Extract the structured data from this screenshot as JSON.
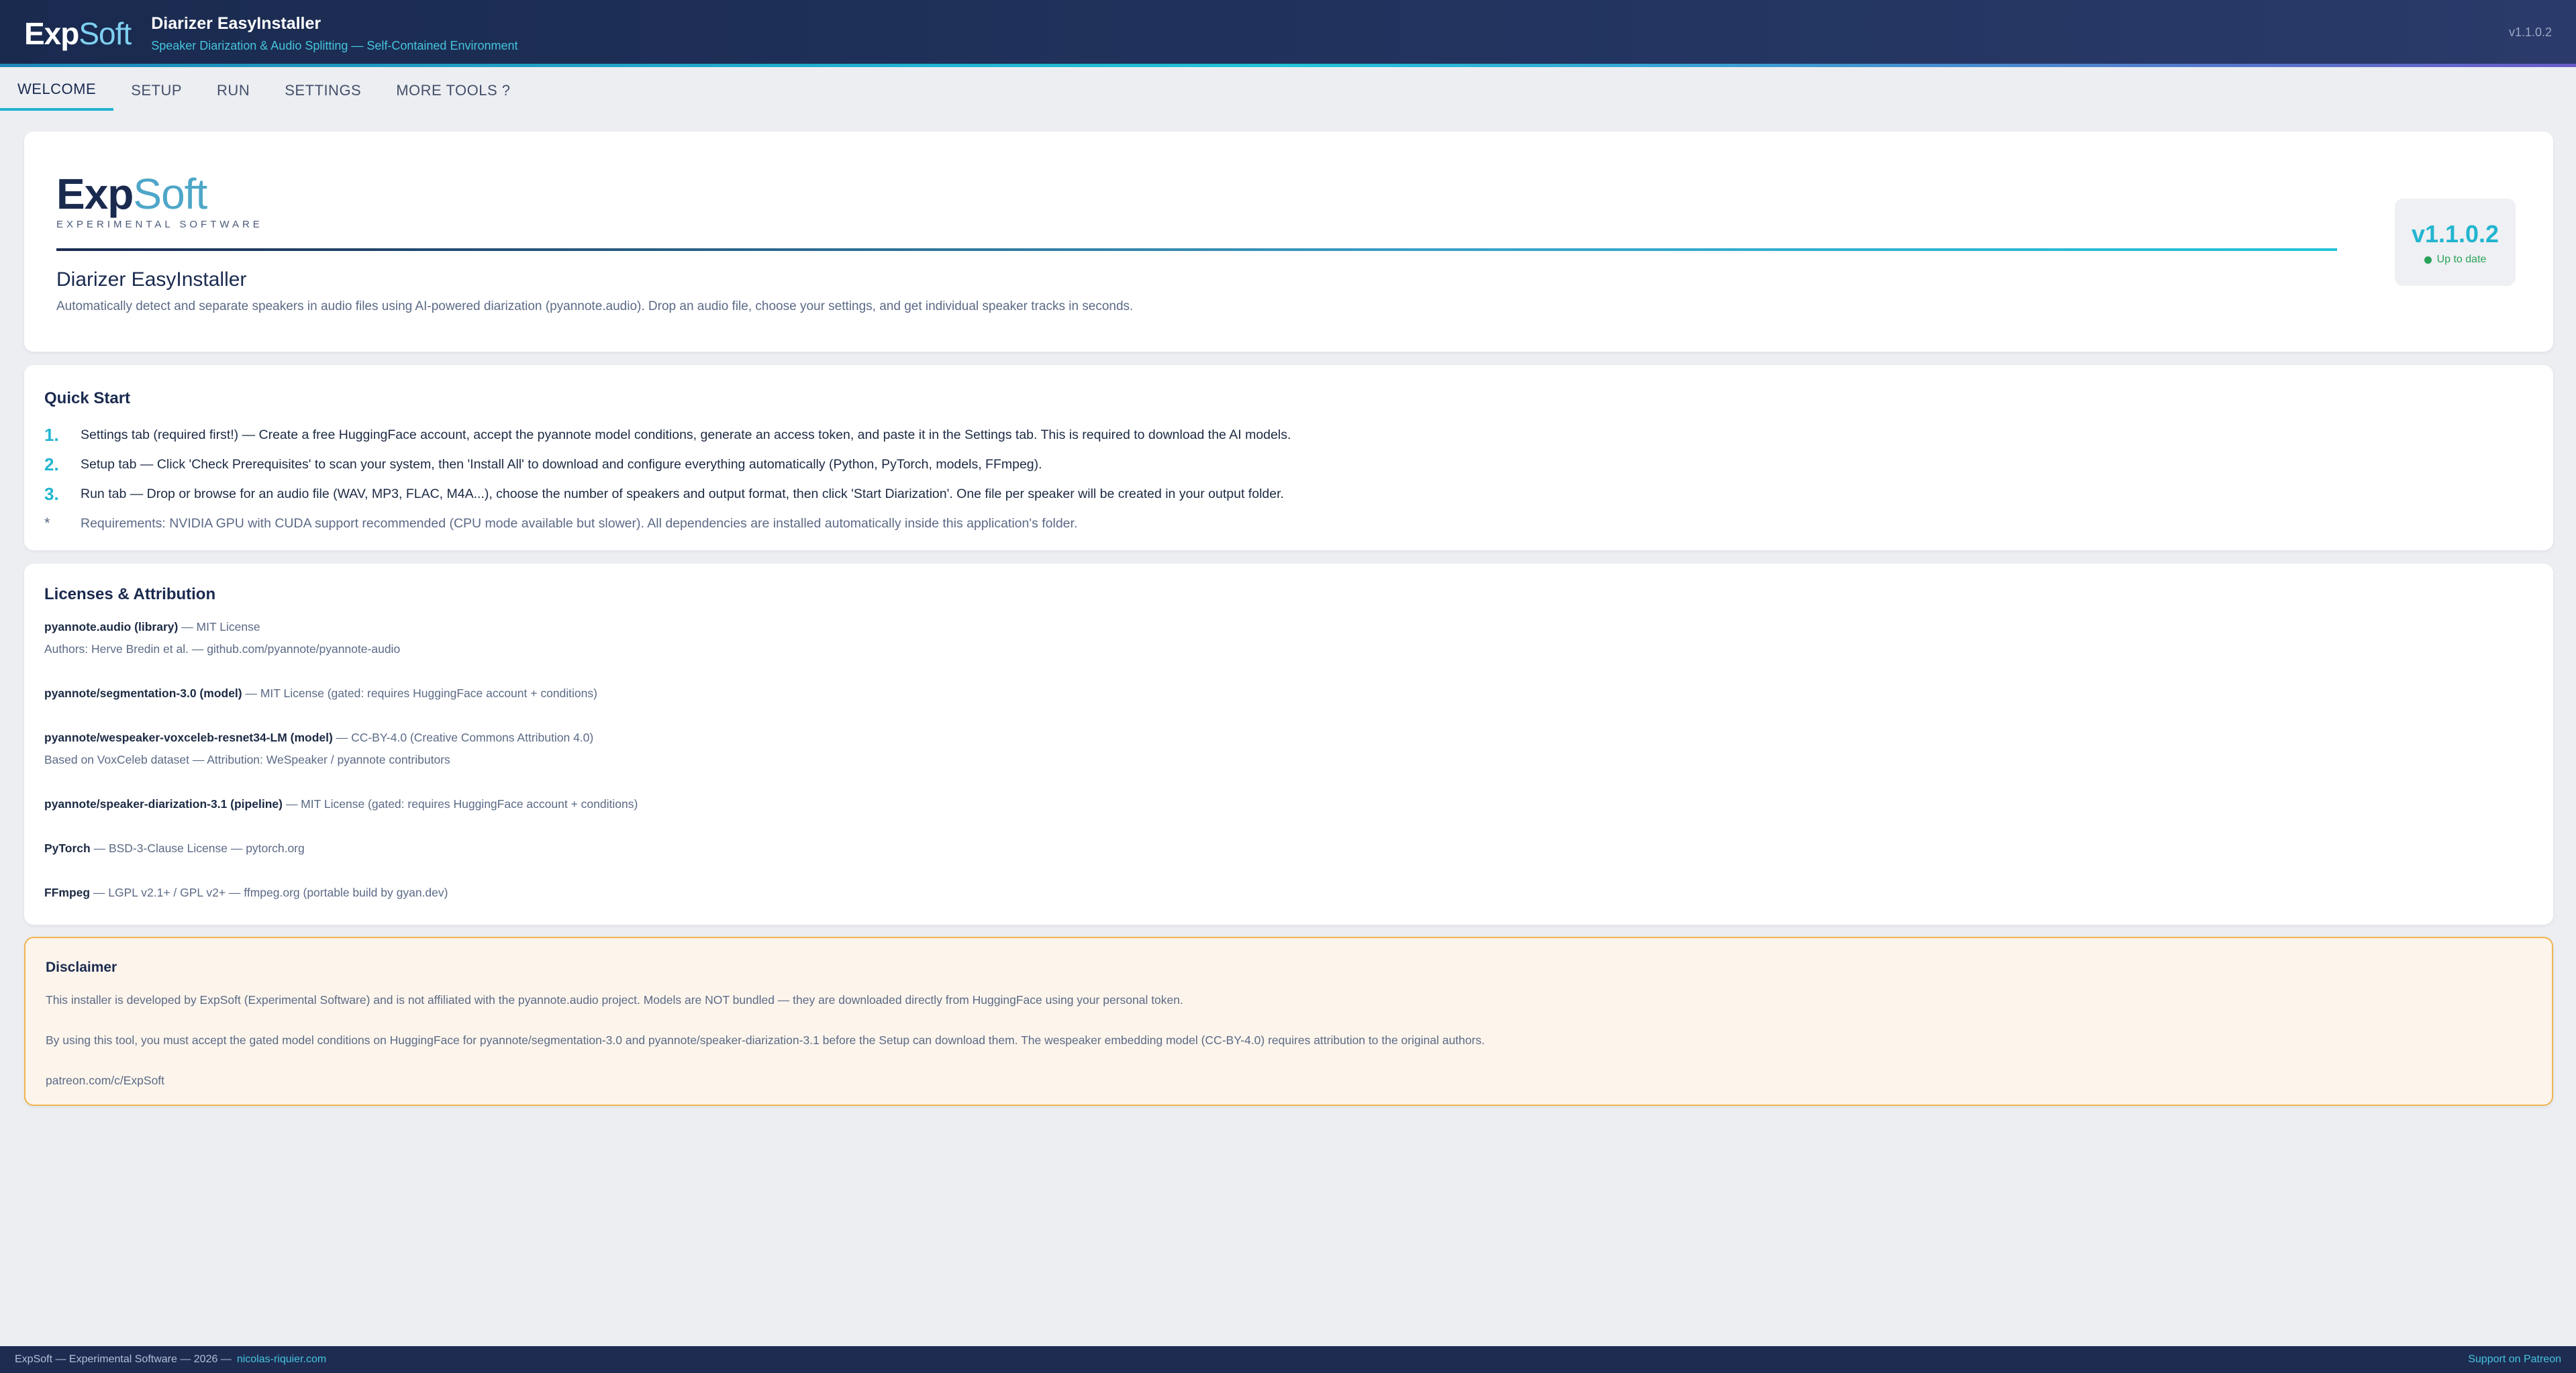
{
  "header": {
    "logo_bold": "Exp",
    "logo_light": "Soft",
    "title": "Diarizer EasyInstaller",
    "subtitle": "Speaker Diarization & Audio Splitting — Self-Contained Environment",
    "version": "v1.1.0.2"
  },
  "tabs": [
    {
      "label": "WELCOME",
      "active": true
    },
    {
      "label": "SETUP",
      "active": false
    },
    {
      "label": "RUN",
      "active": false
    },
    {
      "label": "SETTINGS",
      "active": false
    },
    {
      "label": "MORE TOOLS ?",
      "active": false
    }
  ],
  "welcome": {
    "logo_bold": "Exp",
    "logo_light": "Soft",
    "tagline": "EXPERIMENTAL SOFTWARE",
    "title": "Diarizer EasyInstaller",
    "description": "Automatically detect and separate speakers in audio files using AI-powered diarization (pyannote.audio). Drop an audio file, choose your settings, and get individual speaker tracks in seconds.",
    "version": "v1.1.0.2",
    "version_status": "Up to date"
  },
  "quick_start": {
    "title": "Quick Start",
    "steps": [
      {
        "num": "1.",
        "text": "Settings tab (required first!) — Create a free HuggingFace account, accept the pyannote model conditions, generate an access token, and paste it in the Settings tab. This is required to download the AI models."
      },
      {
        "num": "2.",
        "text": "Setup tab — Click 'Check Prerequisites' to scan your system, then 'Install All' to download and configure everything automatically (Python, PyTorch, models, FFmpeg)."
      },
      {
        "num": "3.",
        "text": "Run tab — Drop or browse for an audio file (WAV, MP3, FLAC, M4A...), choose the number of speakers and output format, then click 'Start Diarization'. One file per speaker will be created in your output folder."
      }
    ],
    "note_marker": "*",
    "note": "Requirements: NVIDIA GPU with CUDA support recommended (CPU mode available but slower). All dependencies are installed automatically inside this application's folder."
  },
  "licenses": {
    "title": "Licenses & Attribution",
    "entries": [
      {
        "name": "pyannote.audio (library)",
        "license": " — MIT License",
        "detail": "Authors: Herve Bredin et al. — github.com/pyannote/pyannote-audio"
      },
      {
        "name": "pyannote/segmentation-3.0 (model)",
        "license": " — MIT License (gated: requires HuggingFace account + conditions)",
        "detail": ""
      },
      {
        "name": "pyannote/wespeaker-voxceleb-resnet34-LM (model)",
        "license": " — CC-BY-4.0 (Creative Commons Attribution 4.0)",
        "detail": "Based on VoxCeleb dataset — Attribution: WeSpeaker / pyannote contributors"
      },
      {
        "name": "pyannote/speaker-diarization-3.1 (pipeline)",
        "license": " — MIT License (gated: requires HuggingFace account + conditions)",
        "detail": ""
      },
      {
        "name": "PyTorch",
        "license": " — BSD-3-Clause License — pytorch.org",
        "detail": ""
      },
      {
        "name": "FFmpeg",
        "license": " — LGPL v2.1+ / GPL v2+ — ffmpeg.org (portable build by gyan.dev)",
        "detail": ""
      }
    ]
  },
  "disclaimer": {
    "title": "Disclaimer",
    "p1": "This installer is developed by ExpSoft (Experimental Software) and is not affiliated with the pyannote.audio project. Models are NOT bundled — they are downloaded directly from HuggingFace using your personal token.",
    "p2": "By using this tool, you must accept the gated model conditions on HuggingFace for pyannote/segmentation-3.0 and pyannote/speaker-diarization-3.1 before the Setup can download them. The wespeaker embedding model (CC-BY-4.0) requires attribution to the original authors.",
    "link": "patreon.com/c/ExpSoft"
  },
  "footer": {
    "left": "ExpSoft — Experimental Software — 2026 —",
    "link": "nicolas-riquier.com",
    "right": "Support on Patreon"
  },
  "colors": {
    "header_bg": "#1a2a4f",
    "accent": "#22b5d0",
    "success": "#2aa35a",
    "disclaimer_border": "#f0b451",
    "disclaimer_bg": "#fdf5ec"
  }
}
